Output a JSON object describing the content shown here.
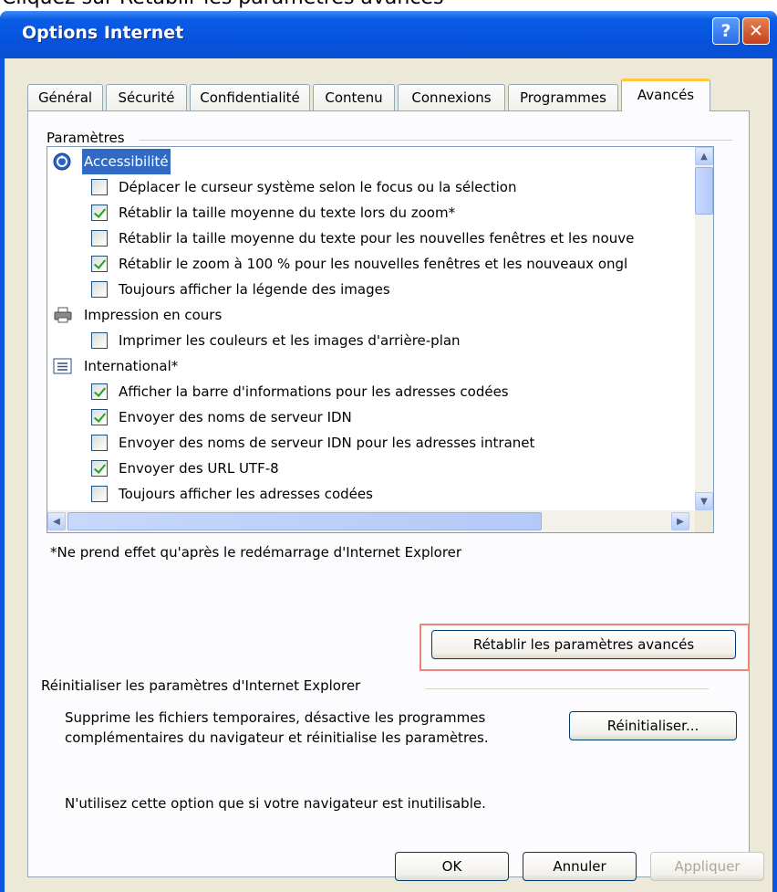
{
  "caption": "Cliquez sur Rétablir les paramètres avancés",
  "window": {
    "title": "Options Internet",
    "help_label": "?",
    "close_label": "✕"
  },
  "tabs": [
    {
      "label": "Général"
    },
    {
      "label": "Sécurité"
    },
    {
      "label": "Confidentialité"
    },
    {
      "label": "Contenu"
    },
    {
      "label": "Connexions"
    },
    {
      "label": "Programmes"
    },
    {
      "label": "Avancés",
      "active": true
    }
  ],
  "settings": {
    "group_label": "Paramètres",
    "items": [
      {
        "kind": "category",
        "label": "Accessibilité",
        "icon": "accessibility-icon",
        "selected": true
      },
      {
        "kind": "checkbox",
        "label": "Déplacer le curseur système selon le focus ou la sélection",
        "checked": false
      },
      {
        "kind": "checkbox",
        "label": "Rétablir la taille moyenne du texte lors du zoom*",
        "checked": true
      },
      {
        "kind": "checkbox",
        "label": "Rétablir la taille moyenne du texte pour les nouvelles fenêtres et les nouve",
        "checked": false
      },
      {
        "kind": "checkbox",
        "label": "Rétablir le zoom à 100 % pour les nouvelles fenêtres et les nouveaux ongl",
        "checked": true
      },
      {
        "kind": "checkbox",
        "label": "Toujours afficher la légende des images",
        "checked": false
      },
      {
        "kind": "category",
        "label": "Impression en cours",
        "icon": "printer-icon",
        "selected": false
      },
      {
        "kind": "checkbox",
        "label": "Imprimer les couleurs et les images d'arrière-plan",
        "checked": false
      },
      {
        "kind": "category",
        "label": "International*",
        "icon": "text-list-icon",
        "selected": false
      },
      {
        "kind": "checkbox",
        "label": "Afficher la barre d'informations pour les adresses codées",
        "checked": true
      },
      {
        "kind": "checkbox",
        "label": "Envoyer des noms de serveur IDN",
        "checked": true
      },
      {
        "kind": "checkbox",
        "label": "Envoyer des noms de serveur IDN pour les adresses intranet",
        "checked": false
      },
      {
        "kind": "checkbox",
        "label": "Envoyer des URL UTF-8",
        "checked": true
      },
      {
        "kind": "checkbox",
        "label": "Toujours afficher les adresses codées",
        "checked": false
      }
    ],
    "restart_note": "*Ne prend effet qu'après le redémarrage d'Internet Explorer",
    "restore_button": "Rétablir les paramètres avancés"
  },
  "reset": {
    "group_label": "Réinitialiser les paramètres d'Internet Explorer",
    "description_line1": "Supprime les fichiers temporaires, désactive les programmes",
    "description_line2": "complémentaires du navigateur et réinitialise les paramètres.",
    "button_label": "Réinitialiser...",
    "warning": "N'utilisez cette option que si votre navigateur est inutilisable."
  },
  "footer": {
    "ok": "OK",
    "cancel": "Annuler",
    "apply": "Appliquer"
  }
}
